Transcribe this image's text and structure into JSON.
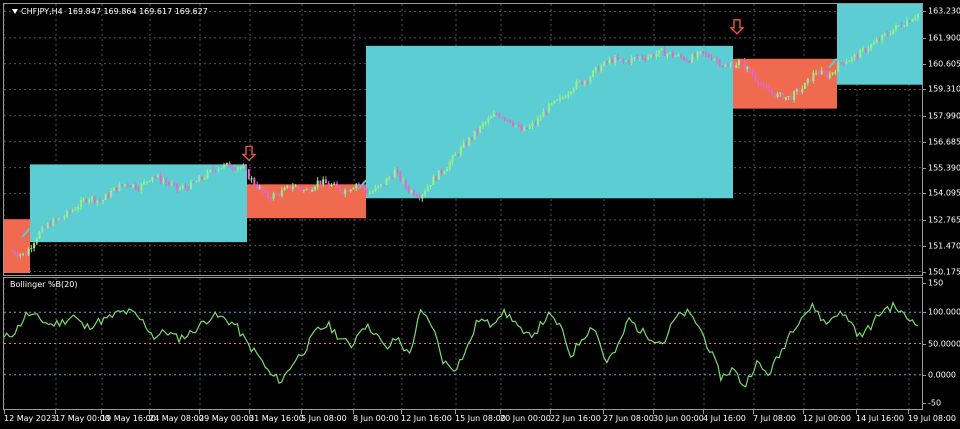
{
  "header": {
    "symbol": "CHFJPY,H4",
    "ohlc": "169.847 169.864 169.617 169.627"
  },
  "indicator": {
    "title": "Bollinger %B(20)"
  },
  "colors": {
    "bull_box": "#5bcdd3",
    "bear_box": "#ef6a4f",
    "bull_candle": "#98f08a",
    "bear_candle": "#e06ac7",
    "indicator_line": "#7ddc6e",
    "level_upper": "#4fb3d9",
    "level_mid": "#e08a3c",
    "level_lower": "#4fb3d9",
    "signal_arrow": "#e8563a"
  },
  "price_axis": [
    "163.230",
    "161.900",
    "160.605",
    "159.310",
    "157.990",
    "156.685",
    "155.390",
    "154.095",
    "152.765",
    "151.470",
    "150.175"
  ],
  "indicator_axis": [
    "150",
    "100.0000",
    "50.0000",
    "0.0000",
    "-50"
  ],
  "time_axis": [
    "12 May 2023",
    "17 May 00:00",
    "19 May 16:00",
    "24 May 08:00",
    "29 May 00:00",
    "31 May 16:00",
    "5 Jun 08:00",
    "8 Jun 00:00",
    "12 Jun 16:00",
    "15 Jun 08:00",
    "20 Jun 00:00",
    "22 Jun 16:00",
    "27 Jun 08:00",
    "30 Jun 00:00",
    "4 Jul 16:00",
    "7 Jul 08:00",
    "12 Jul 00:00",
    "14 Jul 16:00",
    "19 Jul 08:00"
  ],
  "chart_data": {
    "type": "candlestick",
    "symbol": "CHFJPY",
    "timeframe": "H4",
    "price_range": [
      150.0,
      163.6
    ],
    "price_path": [
      151.2,
      151.0,
      152.0,
      152.6,
      152.9,
      153.4,
      153.9,
      153.7,
      154.3,
      154.6,
      154.4,
      155.0,
      154.7,
      154.3,
      154.5,
      154.9,
      155.4,
      155.5,
      155.4,
      154.6,
      153.9,
      154.1,
      154.5,
      154.2,
      154.7,
      154.5,
      154.2,
      154.6,
      154.1,
      154.5,
      155.2,
      154.3,
      154.0,
      154.8,
      155.4,
      156.2,
      156.9,
      157.6,
      158.1,
      157.8,
      157.2,
      157.6,
      158.4,
      158.8,
      159.5,
      159.8,
      160.4,
      160.8,
      160.7,
      160.9,
      161.0,
      161.2,
      161.0,
      160.8,
      161.1,
      160.9,
      160.4,
      160.7,
      160.1,
      159.3,
      159.0,
      158.9,
      159.4,
      160.2,
      160.0,
      160.7,
      160.9,
      161.4,
      161.8,
      162.3,
      162.7,
      163.1
    ],
    "boxes": [
      {
        "direction": "bull",
        "low": 151.65,
        "high": 155.55
      },
      {
        "direction": "bear",
        "low": 152.85,
        "high": 154.55
      },
      {
        "direction": "bull",
        "low": 153.85,
        "high": 161.5
      },
      {
        "direction": "bear",
        "low": 158.35,
        "high": 160.85
      },
      {
        "direction": "bull",
        "low": 159.55,
        "high": 163.6
      }
    ],
    "signals": [
      {
        "type": "sell",
        "price": 155.55
      },
      {
        "type": "sell",
        "price": 161.9
      }
    ],
    "indicator": {
      "name": "Bollinger %B(20)",
      "levels": [
        100,
        50,
        0
      ],
      "range": [
        -55,
        155
      ],
      "values": [
        58,
        70,
        98,
        90,
        80,
        84,
        95,
        75,
        84,
        90,
        100,
        100,
        85,
        60,
        70,
        58,
        65,
        80,
        95,
        90,
        80,
        50,
        30,
        0,
        -10,
        20,
        40,
        70,
        80,
        60,
        45,
        80,
        70,
        40,
        60,
        30,
        100,
        80,
        20,
        10,
        40,
        90,
        80,
        100,
        90,
        60,
        70,
        95,
        80,
        30,
        60,
        80,
        20,
        40,
        90,
        70,
        60,
        50,
        90,
        100,
        80,
        40,
        -5,
        10,
        -20,
        20,
        0,
        30,
        70,
        95,
        110,
        80,
        100,
        90,
        60,
        80,
        105,
        110,
        90,
        85
      ]
    }
  }
}
